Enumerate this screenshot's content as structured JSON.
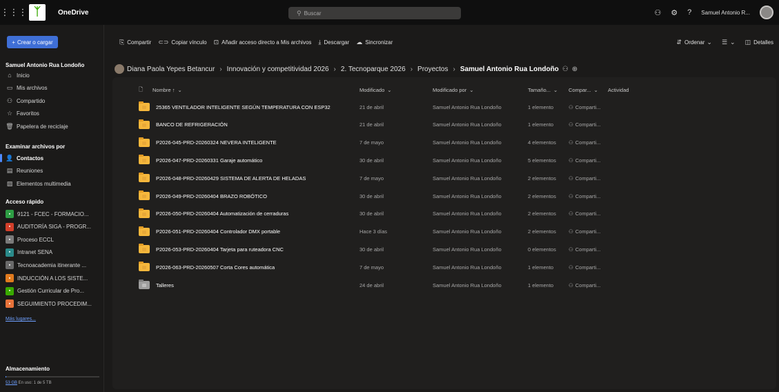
{
  "topbar": {
    "app_name": "OneDrive",
    "search_placeholder": "Buscar",
    "user_name": "Samuel Antonio R..."
  },
  "sidebar": {
    "create_label": "Crear o cargar",
    "owner_title": "Samuel Antonio Rua Londoño",
    "nav": [
      {
        "label": "Inicio",
        "icon": "home-icon"
      },
      {
        "label": "Mis archivos",
        "icon": "folder-icon"
      },
      {
        "label": "Compartido",
        "icon": "people-icon"
      },
      {
        "label": "Favoritos",
        "icon": "star-icon"
      },
      {
        "label": "Papelera de reciclaje",
        "icon": "trash-icon"
      }
    ],
    "browse_title": "Examinar archivos por",
    "browse": [
      {
        "label": "Contactos",
        "icon": "person-icon"
      },
      {
        "label": "Reuniones",
        "icon": "calendar-icon"
      },
      {
        "label": "Elementos multimedia",
        "icon": "image-icon"
      }
    ],
    "quick_title": "Acceso rápido",
    "quick": [
      {
        "label": "9121 - FCEC - FORMACIO...",
        "color": "#2e9e44"
      },
      {
        "label": "AUDITORÍA SIGA - PROGR...",
        "color": "#d23f2a"
      },
      {
        "label": "Proceso ECCL",
        "color": "#7a7a7a"
      },
      {
        "label": "Intranet SENA",
        "color": "#2a8a8a"
      },
      {
        "label": "Tecnoacademia itinerante ...",
        "color": "#6a6a6a"
      },
      {
        "label": "INDUCCIÓN A LOS SISTE...",
        "color": "#e07a1e"
      },
      {
        "label": "Gestión Curricular de Pro...",
        "color": "#39a900"
      },
      {
        "label": "SEGUIMIENTO PROCEDIM...",
        "color": "#e8733a"
      }
    ],
    "more_places": "Más lugares...",
    "storage_title": "Almacenamiento",
    "storage_used": "53 GB",
    "storage_rest": " En uso: 1 de 5 TB",
    "storage_fraction": 0.01
  },
  "commands": {
    "share": "Compartir",
    "copy_link": "Copiar vínculo",
    "add_shortcut": "Añadir acceso directo a Mis archivos",
    "download": "Descargar",
    "sync": "Sincronizar",
    "sort": "Ordenar",
    "details": "Detalles"
  },
  "breadcrumb": {
    "items": [
      "Diana Paola Yepes Betancur",
      "Innovación y competitividad 2026",
      "2. Tecnoparque 2026",
      "Proyectos"
    ],
    "current": "Samuel Antonio Rua Londoño"
  },
  "table": {
    "headers": {
      "name": "Nombre ↑",
      "modified": "Modificado",
      "modified_by": "Modificado por",
      "size": "Tamaño...",
      "sharing": "Compar...",
      "activity": "Actividad"
    },
    "rows": [
      {
        "name": "25365 VENTILADOR INTELIGENTE SEGÚN TEMPERATURA CON ESP32",
        "modified": "21 de abril",
        "by": "Samuel Antonio Rua Londoño",
        "size": "1 elemento",
        "sharing": "Comparti...",
        "grey": false
      },
      {
        "name": "BANCO DE REFRIGERACIÓN",
        "modified": "21 de abril",
        "by": "Samuel Antonio Rua Londoño",
        "size": "1 elemento",
        "sharing": "Comparti...",
        "grey": false
      },
      {
        "name": "P2026-045-PRD-20260324 NEVERA INTELIGENTE",
        "modified": "7 de mayo",
        "by": "Samuel Antonio Rua Londoño",
        "size": "4 elementos",
        "sharing": "Comparti...",
        "grey": false
      },
      {
        "name": "P2026-047-PRD-20260331 Garaje automático",
        "modified": "30 de abril",
        "by": "Samuel Antonio Rua Londoño",
        "size": "5 elementos",
        "sharing": "Comparti...",
        "grey": false
      },
      {
        "name": "P2026-048-PRD-20260429 SISTEMA DE ALERTA DE HELADAS",
        "modified": "7 de mayo",
        "by": "Samuel Antonio Rua Londoño",
        "size": "2 elementos",
        "sharing": "Comparti...",
        "grey": false
      },
      {
        "name": "P2026-049-PRD-20260404 BRAZO ROBÓTICO",
        "modified": "30 de abril",
        "by": "Samuel Antonio Rua Londoño",
        "size": "2 elementos",
        "sharing": "Comparti...",
        "grey": false
      },
      {
        "name": "P2026-050-PRD-20260404 Automatización de cerraduras",
        "modified": "30 de abril",
        "by": "Samuel Antonio Rua Londoño",
        "size": "2 elementos",
        "sharing": "Comparti...",
        "grey": false
      },
      {
        "name": "P2026-051-PRD-20260404 Controlador DMX portable",
        "modified": "Hace 3 días",
        "by": "Samuel Antonio Rua Londoño",
        "size": "2 elementos",
        "sharing": "Comparti...",
        "grey": false
      },
      {
        "name": "P2026-053-PRD-20260404 Tarjeta para ruteadora CNC",
        "modified": "30 de abril",
        "by": "Samuel Antonio Rua Londoño",
        "size": "0 elementos",
        "sharing": "Comparti...",
        "grey": false
      },
      {
        "name": "P2026-063-PRD-20260507 Corta Cores automática",
        "modified": "7 de mayo",
        "by": "Samuel Antonio Rua Londoño",
        "size": "1 elemento",
        "sharing": "Comparti...",
        "grey": false
      },
      {
        "name": "Talleres",
        "modified": "24 de abril",
        "by": "Samuel Antonio Rua Londoño",
        "size": "1 elemento",
        "sharing": "Comparti...",
        "grey": true
      }
    ]
  }
}
